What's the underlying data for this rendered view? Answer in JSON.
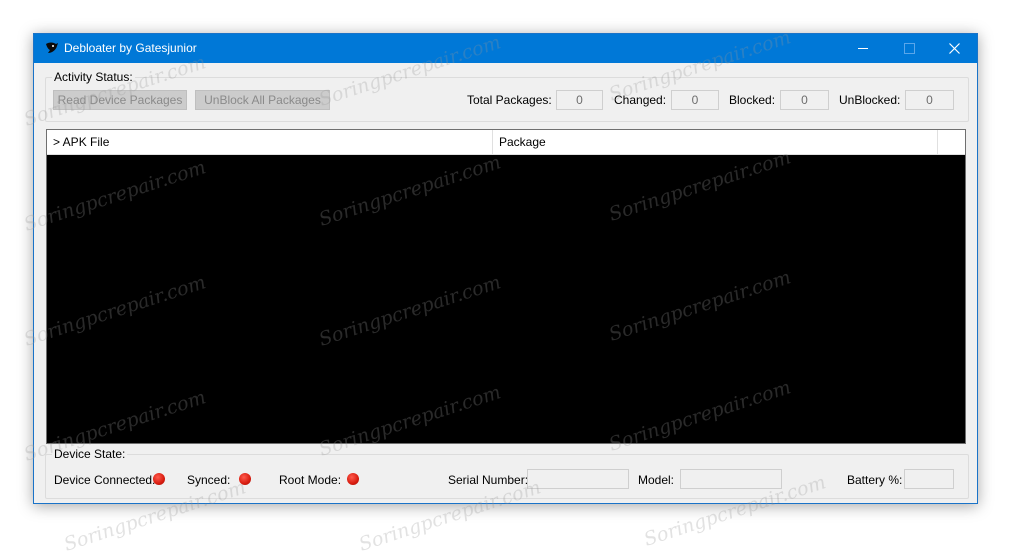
{
  "window": {
    "title": "Debloater by Gatesjunior",
    "controls": {
      "minimize": "minimize",
      "maximize": "maximize",
      "close": "close"
    }
  },
  "activity": {
    "legend": "Activity Status:",
    "read_button": "Read Device Packages",
    "unblock_button": "UnBlock All Packages",
    "total_label": "Total Packages:",
    "total_value": "0",
    "changed_label": "Changed:",
    "changed_value": "0",
    "blocked_label": "Blocked:",
    "blocked_value": "0",
    "unblocked_label": "UnBlocked:",
    "unblocked_value": "0"
  },
  "list": {
    "columns": [
      "> APK File",
      "Package"
    ],
    "rows": []
  },
  "device": {
    "legend": "Device State:",
    "connected_label": "Device Connected:",
    "synced_label": "Synced:",
    "root_label": "Root Mode:",
    "serial_label": "Serial Number:",
    "serial_value": "",
    "model_label": "Model:",
    "model_value": "",
    "battery_label": "Battery %:",
    "battery_value": "",
    "status_color": "#e0261a"
  },
  "watermark": "Soringpcrepair.com"
}
